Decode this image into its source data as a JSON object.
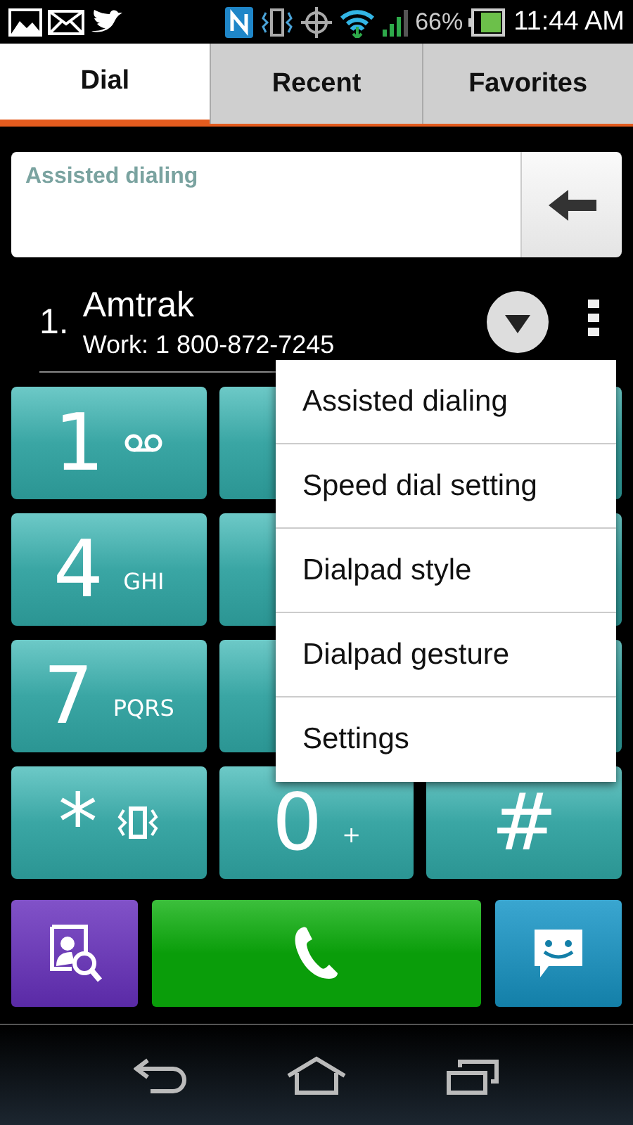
{
  "status_bar": {
    "battery": "66%",
    "time": "11:44 AM"
  },
  "tabs": [
    {
      "label": "Dial",
      "selected": true
    },
    {
      "label": "Recent",
      "selected": false
    },
    {
      "label": "Favorites",
      "selected": false
    }
  ],
  "dial_field": {
    "placeholder": "Assisted dialing"
  },
  "suggestion": {
    "index": "1.",
    "name": "Amtrak",
    "number": "Work: 1 800-872-7245"
  },
  "keypad": [
    {
      "kind": "voicemail_key",
      "digit": "1"
    },
    {
      "kind": "covered"
    },
    {
      "kind": "covered"
    },
    {
      "kind": "key",
      "digit": "4",
      "letters": "GHI"
    },
    {
      "kind": "covered"
    },
    {
      "kind": "covered"
    },
    {
      "kind": "key",
      "digit": "7",
      "letters": "PQRS"
    },
    {
      "kind": "covered"
    },
    {
      "kind": "covered"
    },
    {
      "kind": "vibrate_key",
      "digit": "*"
    },
    {
      "kind": "key",
      "digit": "0",
      "letters": "+"
    },
    {
      "kind": "key",
      "digit": "#"
    }
  ],
  "menu": [
    "Assisted dialing",
    "Speed dial setting",
    "Dialpad style",
    "Dialpad gesture",
    "Settings"
  ]
}
